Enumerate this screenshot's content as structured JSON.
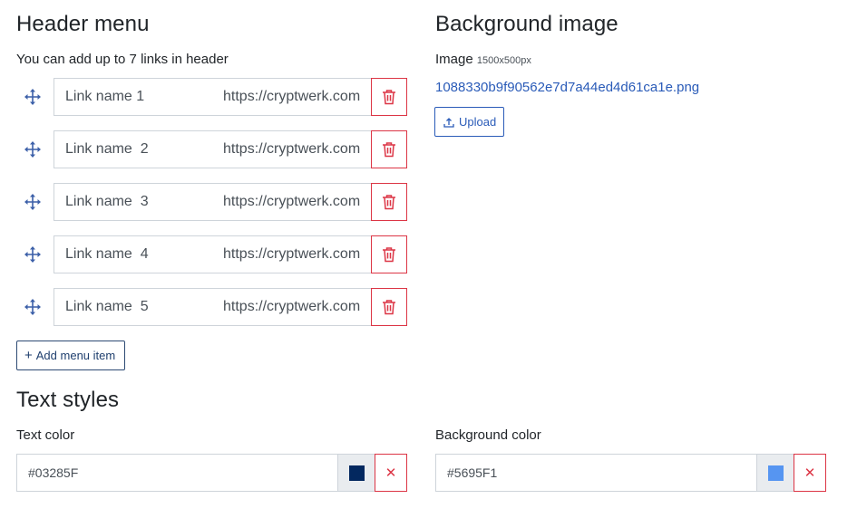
{
  "header_menu": {
    "title": "Header menu",
    "hint": "You can add up to 7 links in header",
    "items": [
      {
        "name": "Link name 1",
        "url": "https://cryptwerk.com"
      },
      {
        "name": "Link name  2",
        "url": "https://cryptwerk.com"
      },
      {
        "name": "Link name  3",
        "url": "https://cryptwerk.com"
      },
      {
        "name": "Link name  4",
        "url": "https://cryptwerk.com"
      },
      {
        "name": "Link name  5",
        "url": "https://cryptwerk.com"
      }
    ],
    "add_label": "Add menu item"
  },
  "background_image": {
    "title": "Background image",
    "image_label": "Image",
    "image_size": "1500x500px",
    "file_name": "1088330b9f90562e7d7a44ed4d61ca1e.png",
    "upload_label": "Upload"
  },
  "text_styles": {
    "title": "Text styles",
    "text_color_label": "Text color",
    "text_color_value": "#03285F",
    "background_color_label": "Background color",
    "background_color_value": "#5695F1"
  },
  "colors": {
    "danger": "#dc3545",
    "accent": "#2a5bb8",
    "drag_icon": "#3b5fa8"
  },
  "icons": {
    "drag": "move-arrows-icon",
    "delete": "trash-icon",
    "add": "plus-icon",
    "upload": "upload-icon",
    "clear": "close-icon"
  }
}
